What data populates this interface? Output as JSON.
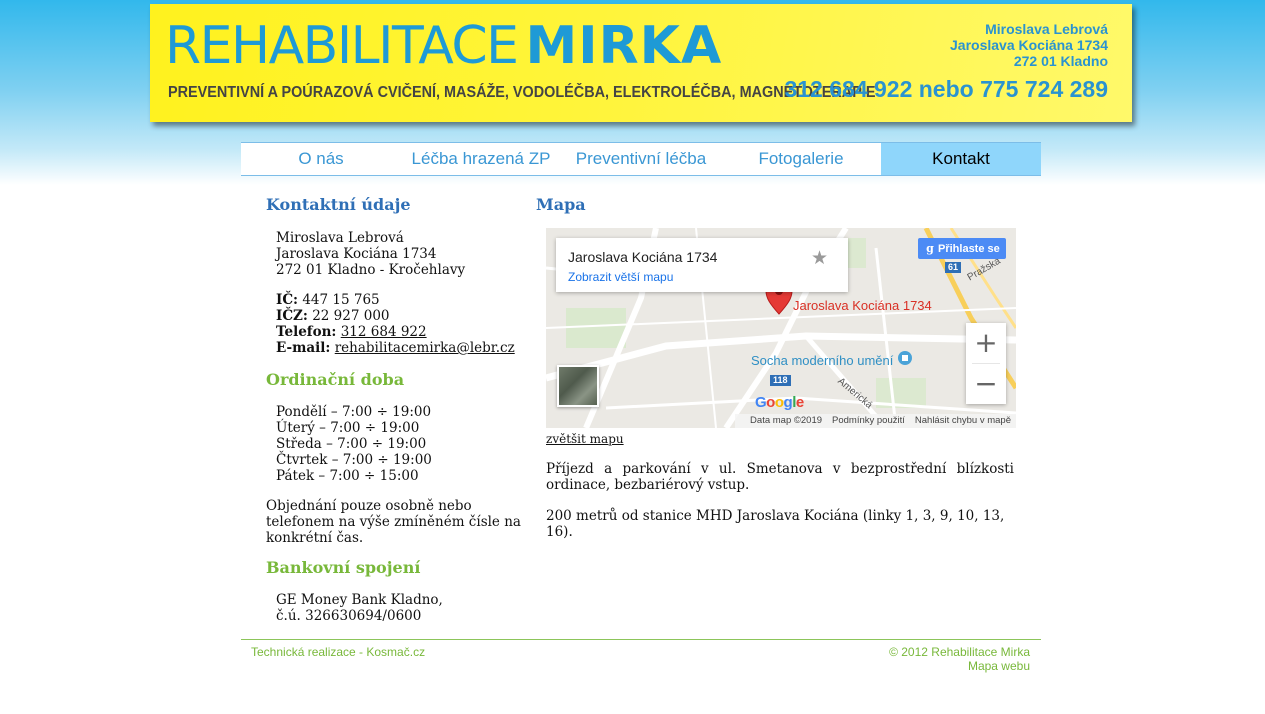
{
  "header": {
    "logo_thin": "REHABILITACE",
    "logo_bold": "MIRKA",
    "tagline": "PREVENTIVNÍ A POÚRAZOVÁ CVIČENÍ, MASÁŽE, VODOLÉČBA, ELEKTROLÉČBA, MAGNETOTERAPIE",
    "address_name": "Miroslava Lebrová",
    "address_street": "Jaroslava Kociána 1734",
    "address_city": "272 01 Kladno",
    "phones": "312 684 922 nebo 775 724 289"
  },
  "nav": {
    "items": [
      {
        "label": "O nás"
      },
      {
        "label": "Léčba hrazená ZP"
      },
      {
        "label": "Preventivní léčba"
      },
      {
        "label": "Fotogalerie"
      },
      {
        "label": "Kontakt",
        "active": true
      }
    ]
  },
  "contact": {
    "heading": "Kontaktní údaje",
    "name": "Miroslava Lebrová",
    "street": "Jaroslava Kociána 1734",
    "city": "272 01 Kladno - Kročehlavy",
    "ic_label": "IČ:",
    "ic_value": "447 15 765",
    "icz_label": "IČZ:",
    "icz_value": "22 927 000",
    "phone_label": "Telefon:",
    "phone_value": "312 684 922",
    "email_label": "E-mail:",
    "email_value": "rehabilitacemirka@lebr.cz"
  },
  "hours": {
    "heading": "Ordinační doba",
    "days": [
      "Pondělí – 7:00 ÷ 19:00",
      "Úterý – 7:00 ÷ 19:00",
      "Středa – 7:00 ÷ 19:00",
      "Čtvrtek – 7:00 ÷ 19:00",
      "Pátek – 7:00 ÷ 15:00"
    ],
    "note": "Objednání pouze osobně nebo telefonem na výše zmíněném čísle na konkrétní čas."
  },
  "bank": {
    "heading": "Bankovní spojení",
    "bank_name": "GE Money Bank Kladno,",
    "account": "č.ú. 326630694/0600"
  },
  "map": {
    "heading": "Mapa",
    "card_title": "Jaroslava Kociána 1734",
    "card_link": "Zobrazit větší mapu",
    "sign_in": "Přihlaste se",
    "marker_label": "Jaroslava Kociána 1734",
    "poi_label": "Socha moderního umění",
    "street_prazska": "Pražská",
    "street_americka": "Americká",
    "road_61": "61",
    "road_118": "118",
    "google_logo": "Google",
    "attribution_data": "Data map ©2019",
    "attribution_terms": "Podmínky použití",
    "attribution_report": "Nahlásit chybu v mapě",
    "enlarge_link": "zvětšit mapu",
    "parking_text": "Příjezd a parkování v ul. Smetanova v bezprostřední blízkosti ordinace, bezbariérový vstup.",
    "transit_text": "200 metrů od stanice MHD Jaroslava Kociána (linky 1, 3, 9, 10, 13, 16)."
  },
  "footer": {
    "credit": "Technická realizace - Kosmač.cz",
    "copyright": "© 2012 Rehabilitace Mirka",
    "sitemap": "Mapa webu"
  },
  "colors": {
    "banner_yellow": "#fff21e",
    "brand_blue": "#1e9ad6",
    "nav_active": "#8fd6fb",
    "heading_blue": "#2f6fb6",
    "heading_green": "#78b83a"
  }
}
